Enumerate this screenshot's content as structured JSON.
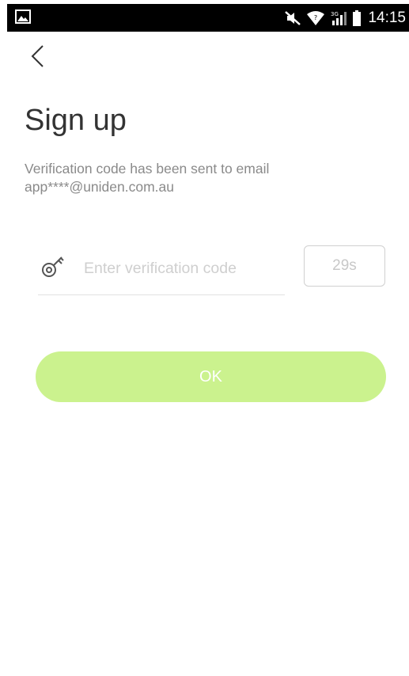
{
  "status_bar": {
    "time": "14:15",
    "network": "3G",
    "icons": [
      "gallery-icon",
      "mute-icon",
      "wifi-icon",
      "signal-icon",
      "battery-icon"
    ]
  },
  "header": {
    "back_icon": "chevron-left-icon"
  },
  "page": {
    "title": "Sign up",
    "info_line1": "Verification code has been sent to email",
    "info_line2": "app****@uniden.com.au"
  },
  "form": {
    "code_icon": "key-icon",
    "code_value": "",
    "code_placeholder": "Enter verification code",
    "countdown_label": "29s",
    "ok_label": "OK"
  },
  "colors": {
    "primary_button": "#cbf28e",
    "title_text": "#333333",
    "secondary_text": "#8a8a8a",
    "placeholder_text": "#cfcfcf",
    "status_bar": "#000000"
  }
}
